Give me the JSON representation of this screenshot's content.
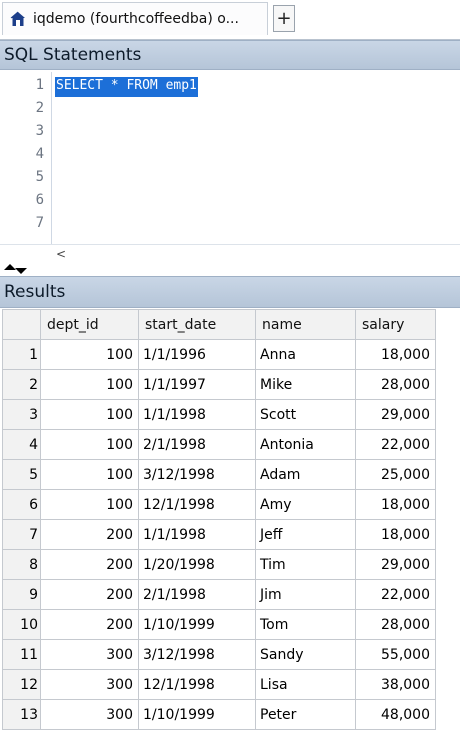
{
  "tab": {
    "title": "iqdemo (fourthcoffeedba) o...",
    "icon": "home-icon",
    "new_tab_label": "+"
  },
  "sql_panel": {
    "title": "SQL Statements",
    "line_numbers": [
      "1",
      "2",
      "3",
      "4",
      "5",
      "6",
      "7"
    ],
    "code": [
      "SELECT * FROM emp1"
    ],
    "scroll_left_label": "<"
  },
  "results_panel": {
    "title": "Results",
    "columns": [
      "dept_id",
      "start_date",
      "name",
      "salary"
    ],
    "rows": [
      [
        "1",
        "100",
        "1/1/1996",
        "Anna",
        "18,000"
      ],
      [
        "2",
        "100",
        "1/1/1997",
        "Mike",
        "28,000"
      ],
      [
        "3",
        "100",
        "1/1/1998",
        "Scott",
        "29,000"
      ],
      [
        "4",
        "100",
        "2/1/1998",
        "Antonia",
        "22,000"
      ],
      [
        "5",
        "100",
        "3/12/1998",
        "Adam",
        "25,000"
      ],
      [
        "6",
        "100",
        "12/1/1998",
        "Amy",
        "18,000"
      ],
      [
        "7",
        "200",
        "1/1/1998",
        "Jeff",
        "18,000"
      ],
      [
        "8",
        "200",
        "1/20/1998",
        "Tim",
        "29,000"
      ],
      [
        "9",
        "200",
        "2/1/1998",
        "Jim",
        "22,000"
      ],
      [
        "10",
        "200",
        "1/10/1999",
        "Tom",
        "28,000"
      ],
      [
        "11",
        "300",
        "3/12/1998",
        "Sandy",
        "55,000"
      ],
      [
        "12",
        "300",
        "12/1/1998",
        "Lisa",
        "38,000"
      ],
      [
        "13",
        "300",
        "1/10/1999",
        "Peter",
        "48,000"
      ]
    ]
  },
  "colors": {
    "panel_header": "#b5c5d8",
    "selection": "#1c6fd8",
    "grid_border": "#c5c9cf"
  }
}
